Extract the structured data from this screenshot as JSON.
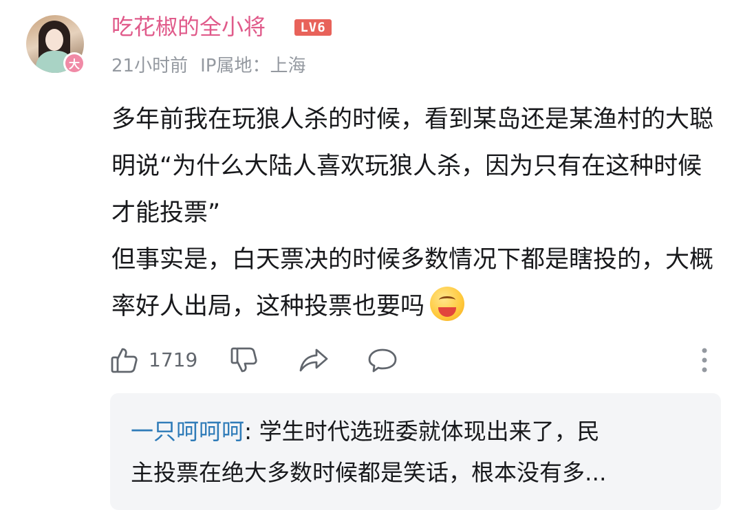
{
  "comment": {
    "author": "吃花椒的全小将",
    "level": "LV6",
    "avatar_badge": "大",
    "time": "21小时前",
    "location": "IP属地：上海",
    "content_paragraphs": [
      "多年前我在玩狼人杀的时候，看到某岛还是某渔村的大聪明说“为什么大陆人喜欢玩狼人杀，因为只有在这种时候才能投票”",
      "但事实是，白天票决的时候多数情况下都是瞎投的，大概率好人出局，这种投票也要吗"
    ],
    "emoji": "eating-watermelon-emoji",
    "like_count": "1719"
  },
  "actions": {
    "like_icon": "thumbs-up-icon",
    "dislike_icon": "thumbs-down-icon",
    "share_icon": "share-icon",
    "reply_icon": "comment-bubble-icon",
    "more_icon": "more-vertical-icon"
  },
  "reply_preview": {
    "author": "一只呵呵呵",
    "separator": ": ",
    "line1_text": "学生时代选班委就体现出来了，民",
    "line2_text": "主投票在绝大多数时候都是笑话，根本没有多..."
  },
  "colors": {
    "username": "#e05a8a",
    "level_badge": "#e8625a",
    "meta_text": "#9499a0",
    "reply_name": "#2e7bb8",
    "reply_background": "#f4f5f7"
  }
}
